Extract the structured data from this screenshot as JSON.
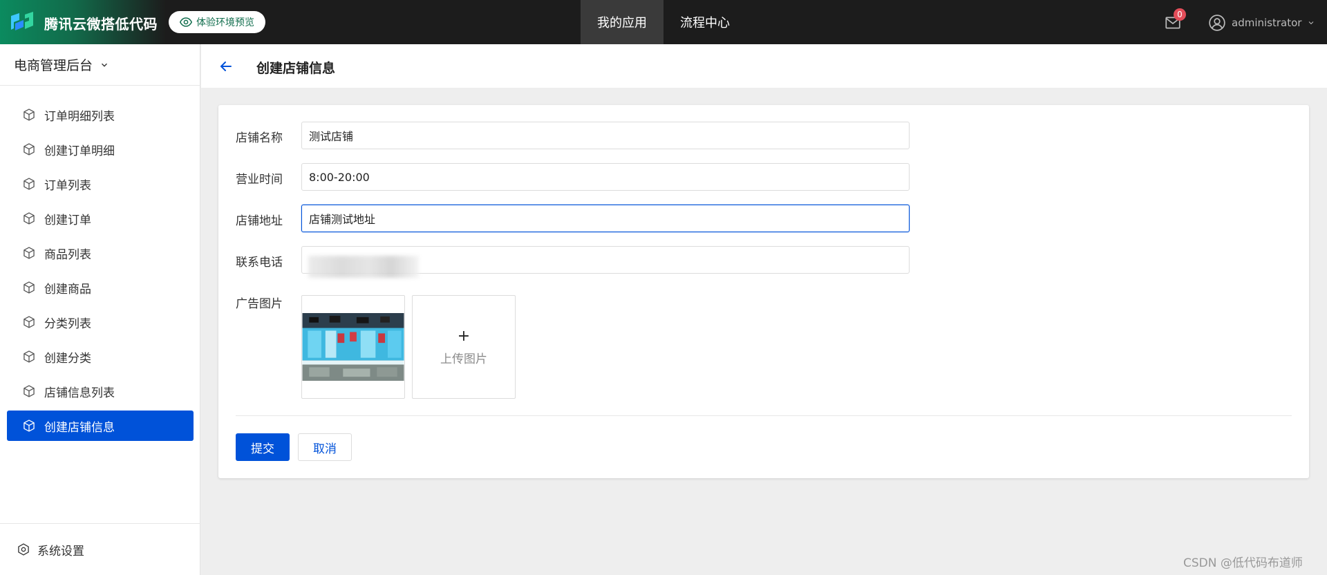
{
  "topbar": {
    "brand_title": "腾讯云微搭低代码",
    "env_badge": "体验环境预览",
    "nav": [
      {
        "label": "我的应用",
        "active": true
      },
      {
        "label": "流程中心",
        "active": false
      }
    ],
    "mail_count": "0",
    "username": "administrator"
  },
  "sidebar": {
    "app_name": "电商管理后台",
    "items": [
      {
        "label": "订单明细列表"
      },
      {
        "label": "创建订单明细"
      },
      {
        "label": "订单列表"
      },
      {
        "label": "创建订单"
      },
      {
        "label": "商品列表"
      },
      {
        "label": "创建商品"
      },
      {
        "label": "分类列表"
      },
      {
        "label": "创建分类"
      },
      {
        "label": "店铺信息列表"
      },
      {
        "label": "创建店铺信息",
        "active": true
      }
    ],
    "settings_label": "系统设置"
  },
  "page": {
    "title": "创建店铺信息"
  },
  "form": {
    "fields": [
      {
        "label": "店铺名称",
        "value": "测试店铺"
      },
      {
        "label": "营业时间",
        "value": "8:00-20:00"
      },
      {
        "label": "店铺地址",
        "value": "店铺测试地址"
      },
      {
        "label": "联系电话",
        "value": ""
      }
    ],
    "image_label": "广告图片",
    "upload_plus": "+",
    "upload_text": "上传图片",
    "submit_label": "提交",
    "cancel_label": "取消"
  },
  "colors": {
    "primary": "#0052d9",
    "topbar": "#1c1c1c",
    "brand_green": "#0b8b5f",
    "badge_red": "#e34d59"
  },
  "watermark": "CSDN @低代码布道师"
}
